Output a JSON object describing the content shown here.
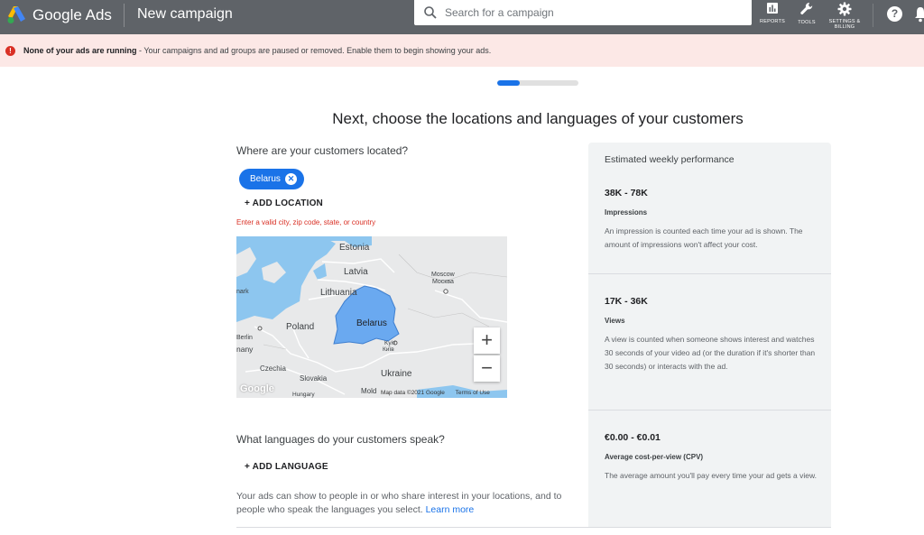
{
  "header": {
    "app_name": "Google Ads",
    "page_title": "New campaign",
    "search_placeholder": "Search for a campaign",
    "tools": [
      {
        "label": "REPORTS",
        "icon": "bar-chart-icon"
      },
      {
        "label": "TOOLS",
        "icon": "wrench-icon"
      },
      {
        "label": "SETTINGS &",
        "label2": "BILLING",
        "icon": "gear-icon"
      }
    ],
    "help_icon": "?"
  },
  "alert": {
    "bold": "None of your ads are running",
    "text": " - Your campaigns and ad groups are paused or removed. Enable them to begin showing your ads.",
    "icon": "!"
  },
  "progress": {
    "fraction": 0.28,
    "color": "#1a73e8"
  },
  "main": {
    "heading": "Next, choose the locations and languages of your customers",
    "locations_question": "Where are your customers located?",
    "selected_location": "Belarus",
    "chip_remove": "✕",
    "add_location": "+ ADD LOCATION",
    "location_error": "Enter a valid city, zip code, state, or country",
    "languages_question": "What languages do your customers speak?",
    "add_language": "+ ADD LANGUAGE",
    "footer_text": "Your ads can show to people in or who share interest in your locations, and to people who speak the languages you select. ",
    "learn_more": "Learn more"
  },
  "map": {
    "labels": {
      "estonia": "Estonia",
      "latvia": "Latvia",
      "lithuania": "Lithuania",
      "belarus": "Belarus",
      "poland": "Poland",
      "ukraine": "Ukraine",
      "czechia": "Czechia",
      "slovakia": "Slovakia",
      "moscow": "Moscow",
      "moscow_local": "Москва",
      "berlin": "Berlin",
      "kyiv_en": "Kyiv",
      "kyiv_local": "Київ",
      "hungary": "Hungary",
      "mold": "Mold",
      "denmark": "nark",
      "germany": "nany",
      "google": "Google"
    },
    "zoom_in": "+",
    "zoom_out": "−",
    "map_data": "Map data ©2021 Google",
    "terms": "Terms of Use",
    "highlight_color": "#6aa9f0",
    "water_color": "#7cc0f0"
  },
  "performance": {
    "title": "Estimated weekly performance",
    "metrics": [
      {
        "range": "38K - 78K",
        "label": "Impressions",
        "desc": "An impression is counted each time your ad is shown. The amount of impressions won't affect your cost."
      },
      {
        "range": "17K - 36K",
        "label": "Views",
        "desc": "A view is counted when someone shows interest and watches 30 seconds of your video ad (or the duration if it's shorter than 30 seconds) or interacts with the ad."
      },
      {
        "range": "€0.00 - €0.01",
        "label": "Average cost-per-view (CPV)",
        "desc": "The average amount you'll pay every time your ad gets a view."
      }
    ]
  }
}
